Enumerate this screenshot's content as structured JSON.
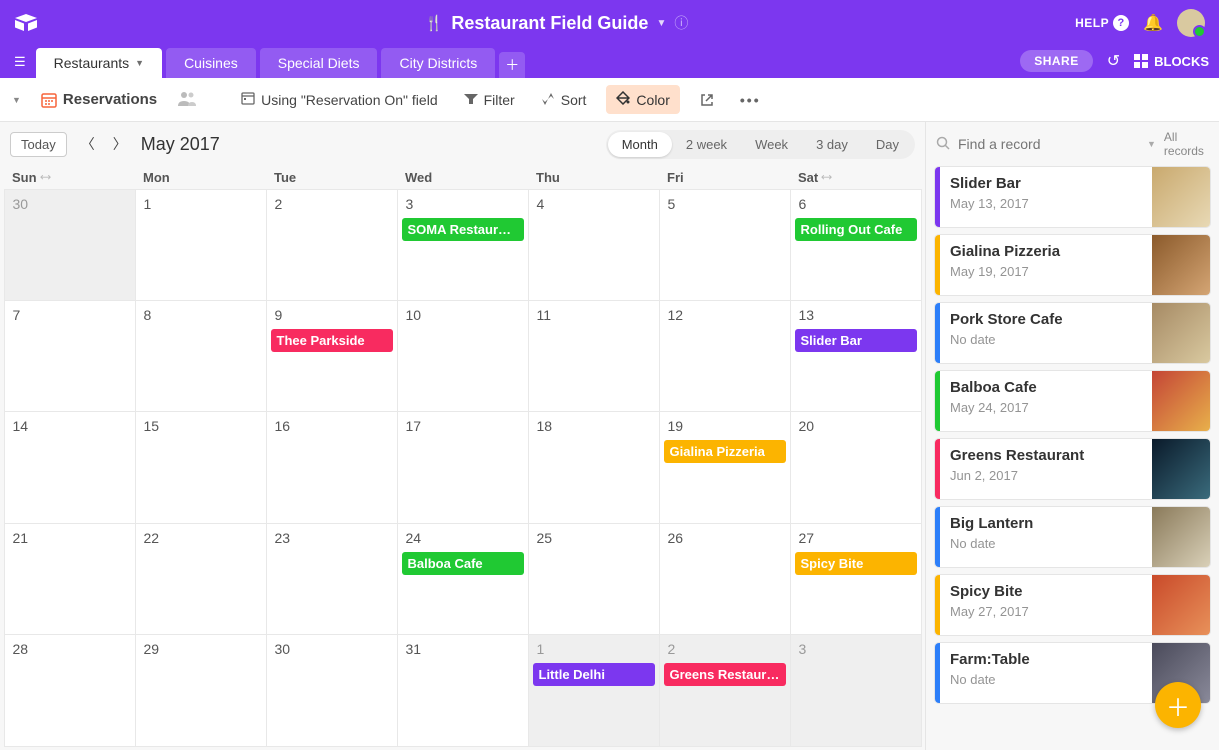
{
  "colors": {
    "green": "#20c933",
    "red": "#f82b60",
    "purple": "#7c37ef",
    "orange": "#fcb400",
    "blue": "#2d7ff9",
    "yellow": "#ffd66e"
  },
  "topbar": {
    "title": "Restaurant Field Guide",
    "help": "HELP",
    "share": "SHARE",
    "blocks": "BLOCKS"
  },
  "tabs": [
    {
      "label": "Restaurants",
      "active": true,
      "hasCaret": true
    },
    {
      "label": "Cuisines",
      "active": false
    },
    {
      "label": "Special Diets",
      "active": false
    },
    {
      "label": "City Districts",
      "active": false
    }
  ],
  "toolbar": {
    "view_name": "Reservations",
    "using": "Using \"Reservation On\" field",
    "filter": "Filter",
    "sort": "Sort",
    "color": "Color"
  },
  "calendar": {
    "today": "Today",
    "month_label": "May 2017",
    "ranges": [
      "Month",
      "2 week",
      "Week",
      "3 day",
      "Day"
    ],
    "active_range": "Month",
    "weekdays": [
      "Sun",
      "Mon",
      "Tue",
      "Wed",
      "Thu",
      "Fri",
      "Sat"
    ],
    "weeks": [
      [
        {
          "n": "30",
          "dim": true
        },
        {
          "n": "1"
        },
        {
          "n": "2"
        },
        {
          "n": "3",
          "events": [
            {
              "t": "SOMA Restauran...",
              "c": "green"
            }
          ]
        },
        {
          "n": "4"
        },
        {
          "n": "5"
        },
        {
          "n": "6",
          "events": [
            {
              "t": "Rolling Out Cafe",
              "c": "green"
            }
          ]
        }
      ],
      [
        {
          "n": "7"
        },
        {
          "n": "8"
        },
        {
          "n": "9",
          "events": [
            {
              "t": "Thee Parkside",
              "c": "red"
            }
          ]
        },
        {
          "n": "10"
        },
        {
          "n": "11"
        },
        {
          "n": "12"
        },
        {
          "n": "13",
          "events": [
            {
              "t": "Slider Bar",
              "c": "purple"
            }
          ]
        }
      ],
      [
        {
          "n": "14"
        },
        {
          "n": "15"
        },
        {
          "n": "16"
        },
        {
          "n": "17"
        },
        {
          "n": "18"
        },
        {
          "n": "19",
          "events": [
            {
              "t": "Gialina Pizzeria",
              "c": "orange"
            }
          ]
        },
        {
          "n": "20"
        }
      ],
      [
        {
          "n": "21"
        },
        {
          "n": "22"
        },
        {
          "n": "23"
        },
        {
          "n": "24",
          "events": [
            {
              "t": "Balboa Cafe",
              "c": "green"
            }
          ]
        },
        {
          "n": "25"
        },
        {
          "n": "26"
        },
        {
          "n": "27",
          "events": [
            {
              "t": "Spicy Bite",
              "c": "orange"
            }
          ]
        }
      ],
      [
        {
          "n": "28"
        },
        {
          "n": "29"
        },
        {
          "n": "30"
        },
        {
          "n": "31"
        },
        {
          "n": "1",
          "dim": true,
          "events": [
            {
              "t": "Little Delhi",
              "c": "purple"
            }
          ]
        },
        {
          "n": "2",
          "dim": true,
          "events": [
            {
              "t": "Greens Restaurant",
              "c": "red"
            }
          ]
        },
        {
          "n": "3",
          "dim": true
        }
      ]
    ]
  },
  "sidebar": {
    "placeholder": "Find a record",
    "all_records": "All records",
    "cards": [
      {
        "title": "Slider Bar",
        "sub": "May 13, 2017",
        "color": "purple",
        "thumb": "#c9a96e,#e8d9b5"
      },
      {
        "title": "Gialina Pizzeria",
        "sub": "May 19, 2017",
        "color": "orange",
        "thumb": "#8b5a2b,#d4a574"
      },
      {
        "title": "Pork Store Cafe",
        "sub": "No date",
        "color": "blue",
        "thumb": "#a68a64,#d9c9a0"
      },
      {
        "title": "Balboa Cafe",
        "sub": "May 24, 2017",
        "color": "green",
        "thumb": "#c44536,#e8b04b"
      },
      {
        "title": "Greens Restaurant",
        "sub": "Jun 2, 2017",
        "color": "red",
        "thumb": "#0a1a2a,#3a6b7c"
      },
      {
        "title": "Big Lantern",
        "sub": "No date",
        "color": "blue",
        "thumb": "#8a7a5a,#d9d0b8"
      },
      {
        "title": "Spicy Bite",
        "sub": "May 27, 2017",
        "color": "orange",
        "thumb": "#c94a2a,#e8915a"
      },
      {
        "title": "Farm:Table",
        "sub": "No date",
        "color": "blue",
        "thumb": "#4a4a5a,#8a8a9a"
      }
    ]
  }
}
